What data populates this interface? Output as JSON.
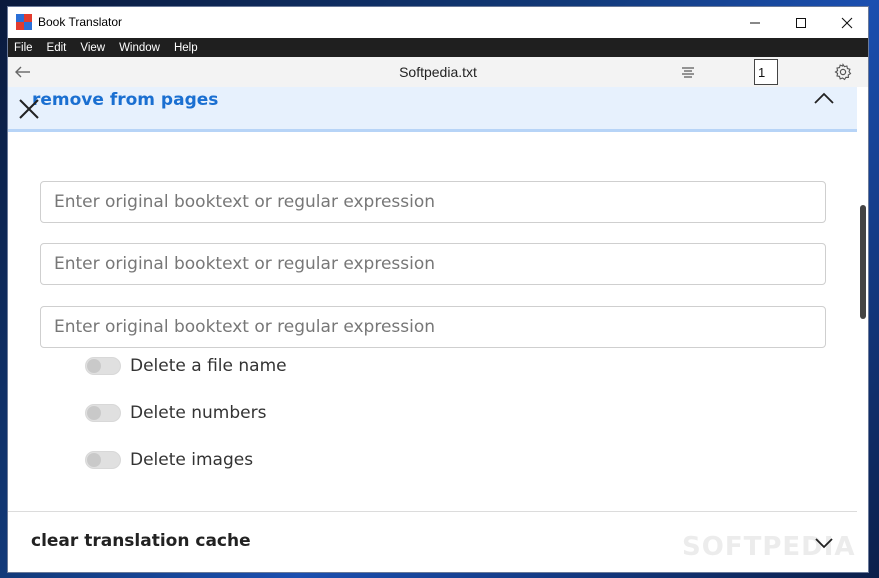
{
  "app": {
    "title": "Book Translator",
    "window_controls": [
      "minimize-icon",
      "maximize-icon",
      "close-icon"
    ]
  },
  "menu": {
    "items": [
      "File",
      "Edit",
      "View",
      "Window",
      "Help"
    ]
  },
  "toolbar": {
    "document_title": "Softpedia.txt",
    "page_number": "1",
    "icons": [
      "back-arrow-icon",
      "table-of-contents-icon",
      "gear-icon"
    ]
  },
  "remove_section": {
    "title": "remove from pages",
    "inputs": [
      {
        "placeholder": "Enter original booktext or regular expression",
        "value": ""
      },
      {
        "placeholder": "Enter original booktext or regular expression",
        "value": ""
      },
      {
        "placeholder": "Enter original booktext or regular expression",
        "value": ""
      }
    ],
    "toggles": [
      {
        "label": "Delete a file name",
        "checked": false
      },
      {
        "label": "Delete numbers",
        "checked": false
      },
      {
        "label": "Delete images",
        "checked": false
      }
    ]
  },
  "cache_section": {
    "title": "clear translation cache"
  },
  "watermark": "SOFTPEDIA",
  "colors": {
    "accent": "#1a6fd1",
    "section_header_bg": "#e7f1fd",
    "menubar_bg": "#1f1f1f"
  }
}
